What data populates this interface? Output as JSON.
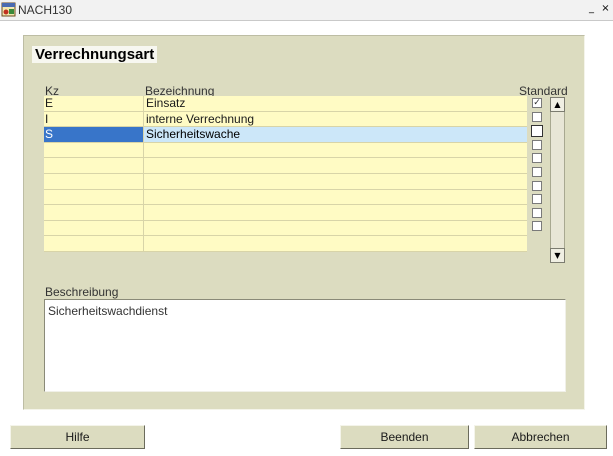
{
  "window": {
    "title": "NACH130",
    "minimize_glyph": "_",
    "close_glyph": "×"
  },
  "group": {
    "title": "Verrechnungsart"
  },
  "table": {
    "headers": {
      "kz": "Kz",
      "bezeichnung": "Bezeichnung",
      "standard": "Standard"
    },
    "rows": [
      {
        "kz": "E",
        "bezeichnung": "Einsatz",
        "standard": true
      },
      {
        "kz": "I",
        "bezeichnung": "interne Verrechnung",
        "standard": false
      },
      {
        "kz": "S",
        "bezeichnung": "Sicherheitswache",
        "standard": false,
        "selected": true
      },
      {
        "kz": "",
        "bezeichnung": "",
        "standard": false
      },
      {
        "kz": "",
        "bezeichnung": "",
        "standard": false
      },
      {
        "kz": "",
        "bezeichnung": "",
        "standard": false
      },
      {
        "kz": "",
        "bezeichnung": "",
        "standard": false
      },
      {
        "kz": "",
        "bezeichnung": "",
        "standard": false
      },
      {
        "kz": "",
        "bezeichnung": "",
        "standard": false
      },
      {
        "kz": "",
        "bezeichnung": "",
        "standard": false
      }
    ],
    "check_glyph": "✓"
  },
  "scrollbar": {
    "up_glyph": "▲",
    "down_glyph": "▼"
  },
  "description": {
    "label": "Beschreibung",
    "value": "Sicherheitswachdienst"
  },
  "buttons": {
    "hilfe": "Hilfe",
    "beenden": "Beenden",
    "abbrechen": "Abbrechen"
  },
  "icons": {
    "app": "app-window-icon"
  },
  "colors": {
    "panel": "#dcdcc0",
    "row": "#fffbc4",
    "selected_kz": "#3875c9",
    "selected_row": "#cce7f9"
  }
}
